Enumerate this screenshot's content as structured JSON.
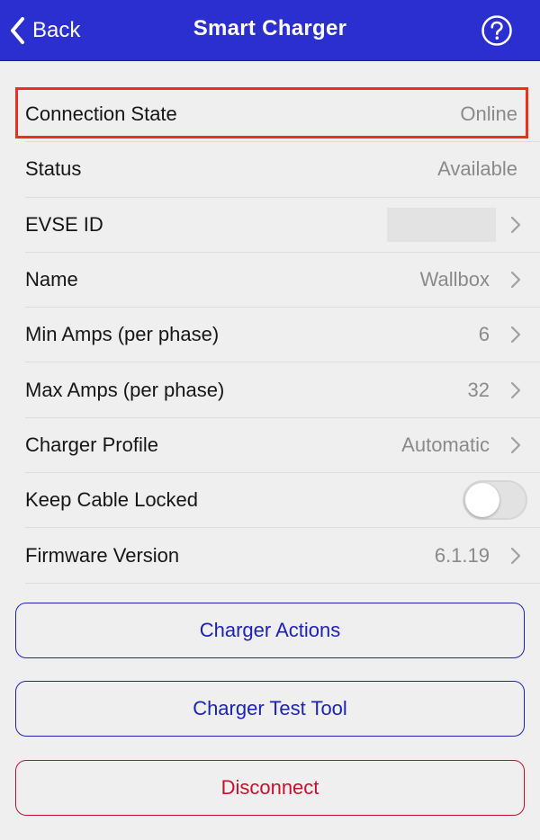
{
  "navbar": {
    "back_label": "Back",
    "title": "Smart Charger",
    "help_icon": "question-circle-icon",
    "color": "#2b2fcf"
  },
  "rows": {
    "connection_state": {
      "label": "Connection State",
      "value": "Online"
    },
    "status": {
      "label": "Status",
      "value": "Available"
    },
    "evse_id": {
      "label": "EVSE ID",
      "value": ""
    },
    "name": {
      "label": "Name",
      "value": "Wallbox"
    },
    "min_amps": {
      "label": "Min Amps (per phase)",
      "value": "6"
    },
    "max_amps": {
      "label": "Max Amps (per phase)",
      "value": "32"
    },
    "charger_profile": {
      "label": "Charger Profile",
      "value": "Automatic"
    },
    "keep_cable_locked": {
      "label": "Keep Cable Locked",
      "toggle_on": false
    },
    "firmware_version": {
      "label": "Firmware Version",
      "value": "6.1.19"
    }
  },
  "buttons": {
    "charger_actions": "Charger Actions",
    "charger_test_tool": "Charger Test Tool",
    "disconnect": "Disconnect"
  },
  "colors": {
    "accent_blue": "#1e22b4",
    "danger_red": "#c8102e",
    "highlight_red": "#e8321e"
  }
}
